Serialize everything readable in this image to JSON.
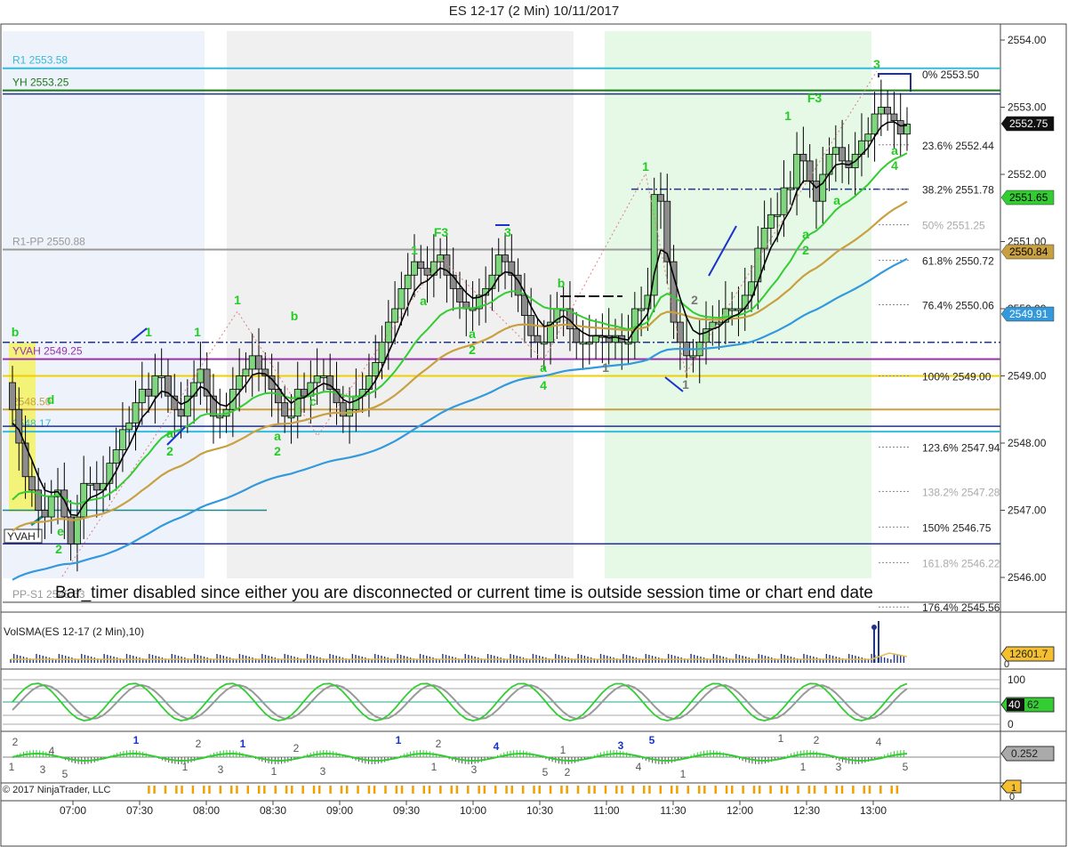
{
  "title": "ES 12-17 (2 Min)  10/11/2017",
  "copyright": "© 2017 NinjaTrader, LLC",
  "message": "Bar_timer disabled since either you are disconnected or current time is outside session time or chart end date",
  "colors": {
    "up": "#7fd67f",
    "down": "#8c8c8c",
    "ema_fast": "#000000",
    "ema_green": "#33cc33",
    "ema_gold": "#c8a040",
    "ema_blue": "#3399dd",
    "shade_gray": "#f0f0f0",
    "shade_blue": "#eef2fb",
    "shade_green": "#e6f8e6",
    "shade_yellow": "#f3f37a"
  },
  "chart_data": [
    {
      "type": "candlestick",
      "name": "ES 12-17 (2 Min)",
      "x_ticks": [
        "07:00",
        "07:30",
        "08:00",
        "08:30",
        "09:00",
        "09:30",
        "10:00",
        "10:30",
        "11:00",
        "11:30",
        "12:00",
        "12:30",
        "13:00"
      ],
      "y_ticks": [
        "2546.00",
        "2547.00",
        "2548.00",
        "2549.00",
        "2550.00",
        "2551.00",
        "2552.00",
        "2553.00",
        "2554.00"
      ],
      "ylim": [
        2545.5,
        2554.2
      ],
      "price_levels": [
        {
          "label": "R1 2553.58",
          "value": 2553.58,
          "color": "#33bbdd"
        },
        {
          "label": "YH 2553.25",
          "value": 2553.25,
          "color": "#1a7a1a"
        },
        {
          "label": "R1-PP 2550.88",
          "value": 2550.88,
          "color": "#999999"
        },
        {
          "label": "YVAH 2549.25",
          "value": 2549.25,
          "color": "#9933aa"
        },
        {
          "label": "2548.50",
          "value": 2548.5,
          "color": "#c8a040"
        },
        {
          "label": "2548.17",
          "value": 2548.17,
          "color": "#33bbdd"
        },
        {
          "label": "PP-S1 2545.63",
          "value": 2545.63,
          "color": "#999999"
        }
      ],
      "fib_levels": [
        {
          "pct": "0%",
          "value": "2553.50"
        },
        {
          "pct": "23.6%",
          "value": "2552.44"
        },
        {
          "pct": "38.2%",
          "value": "2551.78"
        },
        {
          "pct": "50%",
          "value": "2551.25"
        },
        {
          "pct": "61.8%",
          "value": "2550.72"
        },
        {
          "pct": "76.4%",
          "value": "2550.06"
        },
        {
          "pct": "100%",
          "value": "2549.00"
        },
        {
          "pct": "123.6%",
          "value": "2547.94"
        },
        {
          "pct": "138.2%",
          "value": "2547.28"
        },
        {
          "pct": "150%",
          "value": "2546.75"
        },
        {
          "pct": "161.8%",
          "value": "2546.22"
        },
        {
          "pct": "176.4%",
          "value": "2545.56"
        }
      ],
      "price_tags": [
        {
          "text": "2552.75",
          "bg": "#111111",
          "fg": "#ffffff"
        },
        {
          "text": "2551.65",
          "bg": "#33cc33",
          "fg": "#000000"
        },
        {
          "text": "2550.84",
          "bg": "#c8a040",
          "fg": "#000000"
        },
        {
          "text": "2549.91",
          "bg": "#3399dd",
          "fg": "#ffffff"
        }
      ],
      "closes": [
        2548.5,
        2548.0,
        2547.5,
        2547.3,
        2547.0,
        2546.9,
        2547.2,
        2547.3,
        2546.9,
        2546.5,
        2546.9,
        2547.4,
        2547.4,
        2547.3,
        2547.4,
        2547.7,
        2547.9,
        2548.2,
        2548.3,
        2548.6,
        2548.8,
        2548.7,
        2549.0,
        2549.0,
        2548.7,
        2548.5,
        2548.4,
        2548.7,
        2548.9,
        2549.1,
        2548.7,
        2548.4,
        2548.4,
        2548.5,
        2548.8,
        2549.0,
        2549.1,
        2549.3,
        2549.1,
        2549.0,
        2548.8,
        2548.6,
        2548.4,
        2548.4,
        2548.8,
        2548.7,
        2548.9,
        2549.0,
        2549.0,
        2548.8,
        2548.6,
        2548.4,
        2548.5,
        2548.7,
        2548.8,
        2549.0,
        2549.2,
        2549.5,
        2549.8,
        2550.0,
        2550.3,
        2550.5,
        2550.7,
        2550.6,
        2550.5,
        2550.7,
        2550.8,
        2550.5,
        2550.3,
        2550.1,
        2550.0,
        2550.0,
        2550.2,
        2550.3,
        2550.5,
        2550.8,
        2550.7,
        2550.5,
        2550.2,
        2549.9,
        2549.6,
        2549.5,
        2549.5,
        2549.8,
        2550.0,
        2550.0,
        2549.7,
        2549.5,
        2549.5,
        2549.5,
        2549.6,
        2549.6,
        2549.5,
        2549.6,
        2549.5,
        2549.5,
        2550.0,
        2550.0,
        2550.2,
        2551.7,
        2551.6,
        2550.7,
        2549.8,
        2549.5,
        2549.3,
        2549.3,
        2549.5,
        2549.7,
        2549.8,
        2549.8,
        2550.0,
        2550.0,
        2550.0,
        2550.2,
        2550.4,
        2550.9,
        2551.2,
        2551.4,
        2551.4,
        2551.8,
        2551.8,
        2552.3,
        2552.2,
        2551.9,
        2551.6,
        2552.0,
        2552.3,
        2552.4,
        2552.2,
        2552.1,
        2552.3,
        2552.5,
        2552.6,
        2552.9,
        2553.0,
        2552.9,
        2552.8,
        2552.6,
        2552.75
      ]
    },
    {
      "type": "bar",
      "name": "VolSMA(ES 12-17 (2 Min),10)",
      "last_value": "12601.7",
      "ylim": [
        0,
        70000
      ]
    },
    {
      "type": "line",
      "name": "stochastic",
      "y_ticks": [
        "100",
        "0"
      ],
      "ylim": [
        0,
        100
      ],
      "tag_values": [
        "40",
        "62"
      ]
    },
    {
      "type": "bar",
      "name": "momentum histogram",
      "tag_value": "0.252"
    },
    {
      "type": "bar",
      "name": "timing marks",
      "tag_value": "1",
      "y_ticks": [
        "0"
      ]
    }
  ]
}
